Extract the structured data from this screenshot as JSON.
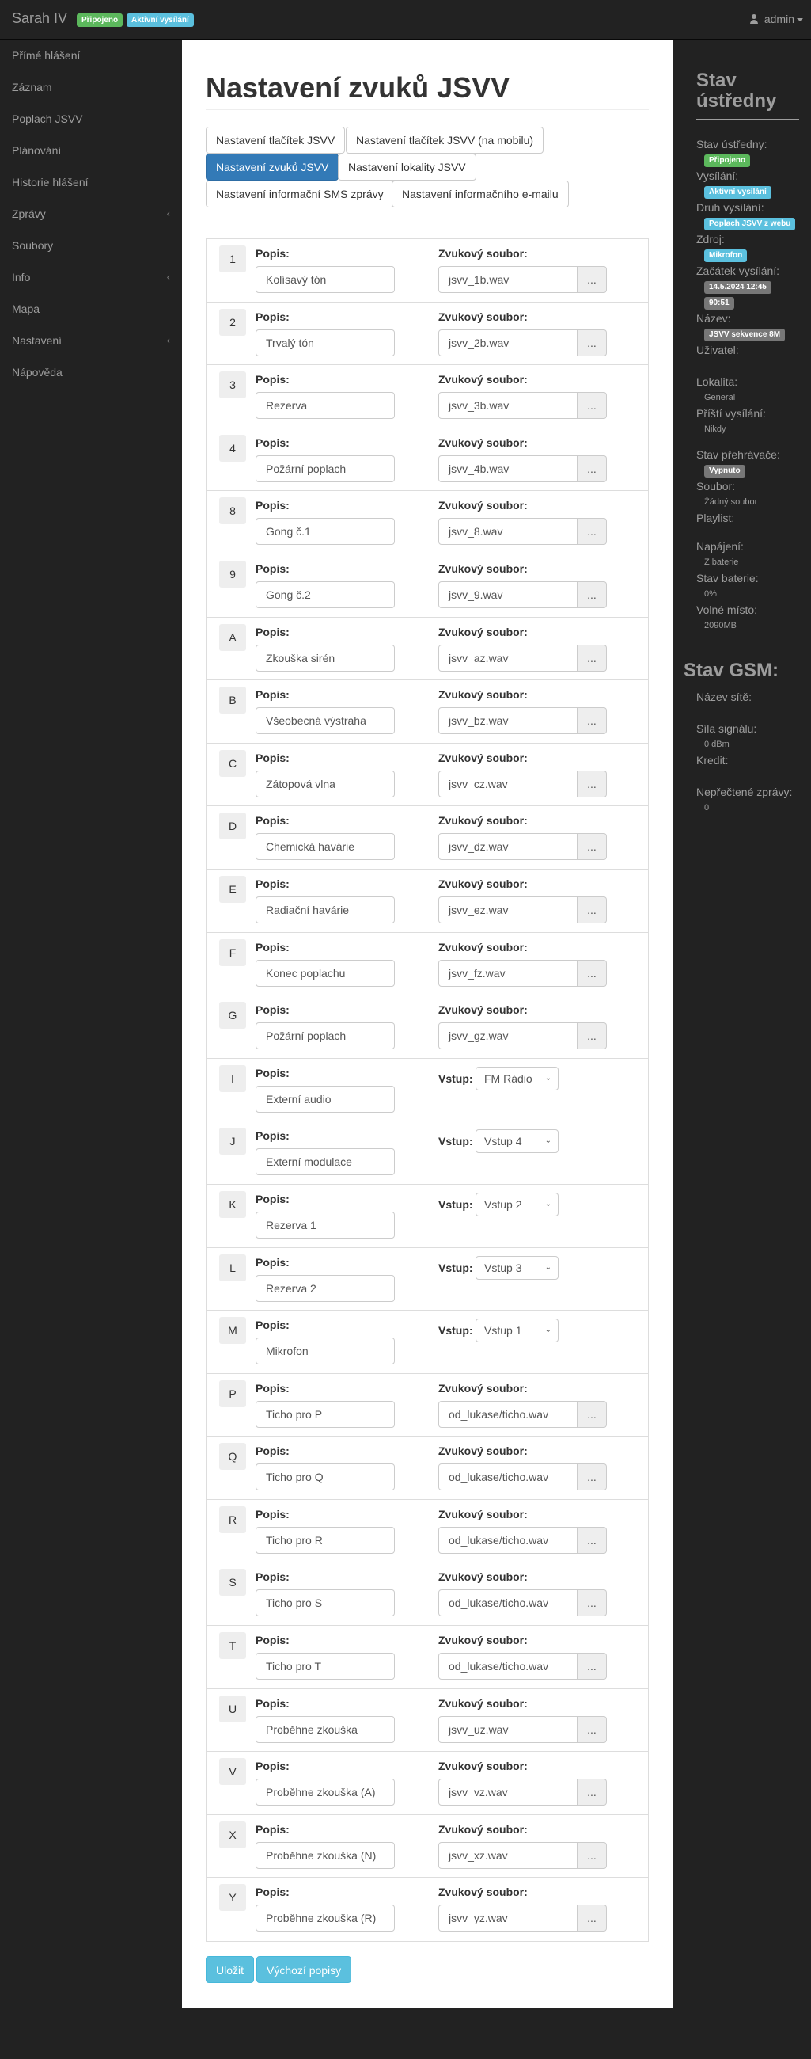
{
  "navbar": {
    "brand": "Sarah IV",
    "badge_connected": "Připojeno",
    "badge_broadcast": "Aktivní vysílání",
    "user": "admin",
    "colors": {
      "green": "#5cb85c",
      "blue": "#5bc0de"
    }
  },
  "sidebar": {
    "items": [
      {
        "label": "Přímé hlášení"
      },
      {
        "label": "Záznam"
      },
      {
        "label": "Poplach JSVV"
      },
      {
        "label": "Plánování"
      },
      {
        "label": "Historie hlášení"
      },
      {
        "label": "Zprávy",
        "submenu": true
      },
      {
        "label": "Soubory"
      },
      {
        "label": "Info",
        "submenu": true
      },
      {
        "label": "Mapa"
      },
      {
        "label": "Nastavení",
        "submenu": true
      },
      {
        "label": "Nápověda"
      }
    ],
    "chevron": "‹"
  },
  "main": {
    "title": "Nastavení zvuků JSVV",
    "tabs": [
      {
        "label": "Nastavení tlačítek JSVV"
      },
      {
        "label": "Nastavení tlačítek JSVV (na mobilu)"
      },
      {
        "label": "Nastavení zvuků JSVV",
        "active": true
      },
      {
        "label": "Nastavení lokality JSVV"
      },
      {
        "label": "Nastavení informační SMS zprávy"
      },
      {
        "label": "Nastavení informačního e-mailu"
      }
    ],
    "labels": {
      "popis": "Popis:",
      "zvuk": "Zvukový soubor:",
      "vstup": "Vstup:",
      "browse": "..."
    },
    "sounds": [
      {
        "key": "1",
        "description": "Kolísavý tón",
        "file": "jsvv_1b.wav"
      },
      {
        "key": "2",
        "description": "Trvalý tón",
        "file": "jsvv_2b.wav"
      },
      {
        "key": "3",
        "description": "Rezerva",
        "file": "jsvv_3b.wav"
      },
      {
        "key": "4",
        "description": "Požární poplach",
        "file": "jsvv_4b.wav"
      },
      {
        "key": "8",
        "description": "Gong č.1",
        "file": "jsvv_8.wav"
      },
      {
        "key": "9",
        "description": "Gong č.2",
        "file": "jsvv_9.wav"
      },
      {
        "key": "A",
        "description": "Zkouška sirén",
        "file": "jsvv_az.wav"
      },
      {
        "key": "B",
        "description": "Všeobecná výstraha",
        "file": "jsvv_bz.wav"
      },
      {
        "key": "C",
        "description": "Zátopová vlna",
        "file": "jsvv_cz.wav"
      },
      {
        "key": "D",
        "description": "Chemická havárie",
        "file": "jsvv_dz.wav"
      },
      {
        "key": "E",
        "description": "Radiační havárie",
        "file": "jsvv_ez.wav"
      },
      {
        "key": "F",
        "description": "Konec poplachu",
        "file": "jsvv_fz.wav"
      },
      {
        "key": "G",
        "description": "Požární poplach",
        "file": "jsvv_gz.wav"
      },
      {
        "key": "I",
        "description": "Externí audio",
        "input": "FM Rádio"
      },
      {
        "key": "J",
        "description": "Externí modulace",
        "input": "Vstup 4"
      },
      {
        "key": "K",
        "description": "Rezerva 1",
        "input": "Vstup 2"
      },
      {
        "key": "L",
        "description": "Rezerva 2",
        "input": "Vstup 3"
      },
      {
        "key": "M",
        "description": "Mikrofon",
        "input": "Vstup 1"
      },
      {
        "key": "P",
        "description": "Ticho pro P",
        "file": "od_lukase/ticho.wav"
      },
      {
        "key": "Q",
        "description": "Ticho pro Q",
        "file": "od_lukase/ticho.wav"
      },
      {
        "key": "R",
        "description": "Ticho pro R",
        "file": "od_lukase/ticho.wav"
      },
      {
        "key": "S",
        "description": "Ticho pro S",
        "file": "od_lukase/ticho.wav"
      },
      {
        "key": "T",
        "description": "Ticho pro T",
        "file": "od_lukase/ticho.wav"
      },
      {
        "key": "U",
        "description": "Proběhne zkouška",
        "file": "jsvv_uz.wav"
      },
      {
        "key": "V",
        "description": "Proběhne zkouška (A)",
        "file": "jsvv_vz.wav"
      },
      {
        "key": "X",
        "description": "Proběhne zkouška (N)",
        "file": "jsvv_xz.wav"
      },
      {
        "key": "Y",
        "description": "Proběhne zkouška (R)",
        "file": "jsvv_yz.wav"
      }
    ],
    "save_label": "Uložit",
    "defaults_label": "Výchozí popisy"
  },
  "status": {
    "title_line1": "Stav",
    "title_line2": "ústředny",
    "stav_ustredny_label": "Stav ústředny:",
    "stav_ustredny": "Připojeno",
    "vysilani_label": "Vysílání:",
    "vysilani": "Aktivní vysílání",
    "druh_label": "Druh vysílání:",
    "druh": "Poplach JSVV z webu",
    "zdroj_label": "Zdroj:",
    "zdroj": "Mikrofon",
    "zacatek_label": "Začátek vysílání:",
    "zacatek_datum": "14.5.2024 12:45",
    "zacatek_cas": "90:51",
    "nazev_label": "Název:",
    "nazev": "JSVV sekvence 8M",
    "uzivatel_label": "Uživatel:",
    "lokalita_label": "Lokalita:",
    "lokalita": "General",
    "pristi_label": "Příští vysílání:",
    "pristi": "Nikdy",
    "prehravac_label": "Stav přehrávače:",
    "prehravac": "Vypnuto",
    "soubor_label": "Soubor:",
    "soubor": "Žádný soubor",
    "playlist_label": "Playlist:",
    "napajeni_label": "Napájení:",
    "napajeni": "Z baterie",
    "baterie_label": "Stav baterie:",
    "baterie": "0%",
    "volne_label": "Volné místo:",
    "volne": "2090MB"
  },
  "gsm": {
    "title": "Stav GSM:",
    "nazev_site_label": "Název sítě:",
    "sila_label": "Síla signálu:",
    "sila": "0 dBm",
    "kredit_label": "Kredit:",
    "zpravy_label": "Nepřečtené zprávy:",
    "zpravy": "0"
  }
}
